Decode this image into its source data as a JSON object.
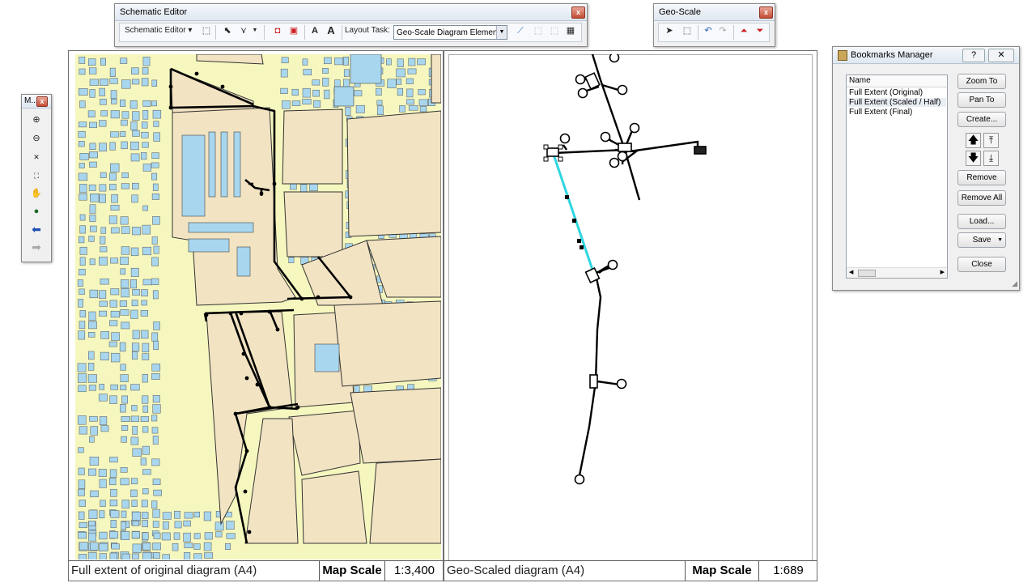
{
  "schematic_editor": {
    "title": "Schematic Editor",
    "menu_label": "Schematic Editor ▾",
    "layout_task_label": "Layout Task:",
    "layout_task_value": "Geo-Scale Diagram Elements"
  },
  "geo_scale": {
    "title": "Geo-Scale"
  },
  "magnifier": {
    "title": "M..."
  },
  "left_map": {
    "caption": "Full extent of original diagram (A4)",
    "scale_label": "Map Scale",
    "scale_value": "1:3,400"
  },
  "right_map": {
    "caption": "Geo-Scaled diagram (A4)",
    "scale_label": "Map Scale",
    "scale_value": "1:689"
  },
  "bookmarks": {
    "title": "Bookmarks Manager",
    "column_header": "Name",
    "items": [
      "Full Extent (Original)",
      "Full Extent (Scaled / Half)",
      "Full Extent (Final)"
    ],
    "buttons": {
      "zoom_to": "Zoom To",
      "pan_to": "Pan To",
      "create": "Create...",
      "remove": "Remove",
      "remove_all": "Remove All",
      "load": "Load...",
      "save": "Save",
      "close": "Close"
    }
  },
  "colors": {
    "parcel": "#f2e3c2",
    "background": "#f5f7bf",
    "building": "#a8d6ee",
    "highlight": "#2fd6e0"
  }
}
